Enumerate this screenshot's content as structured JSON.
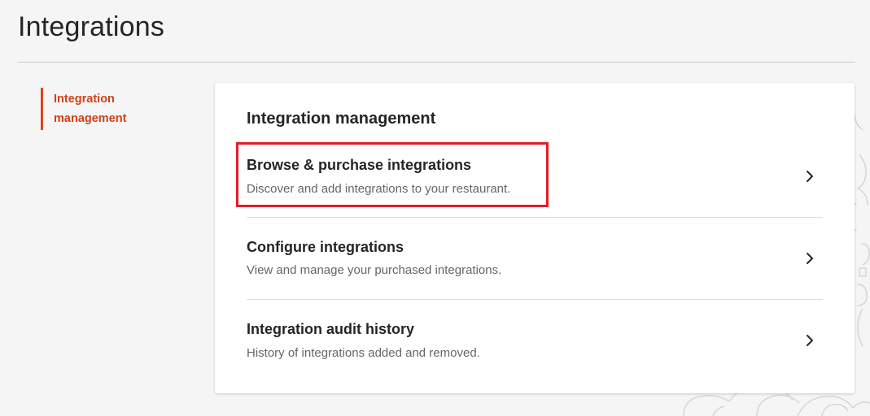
{
  "header": {
    "title": "Integrations"
  },
  "sidebar": {
    "items": [
      {
        "label": "Integration management",
        "active": true
      }
    ]
  },
  "card": {
    "title": "Integration management",
    "rows": [
      {
        "title": "Browse & purchase integrations",
        "description": "Discover and add integrations to your restaurant.",
        "icon": "chevron-right-icon",
        "highlighted": true
      },
      {
        "title": "Configure integrations",
        "description": "View and manage your purchased integrations.",
        "icon": "chevron-right-icon"
      },
      {
        "title": "Integration audit history",
        "description": "History of integrations added and removed.",
        "icon": "chevron-right-icon"
      }
    ]
  },
  "colors": {
    "accent": "#e0431c",
    "highlight": "#e11d2a",
    "text": "#252525",
    "muted": "#666666",
    "background": "#f5f5f5"
  }
}
